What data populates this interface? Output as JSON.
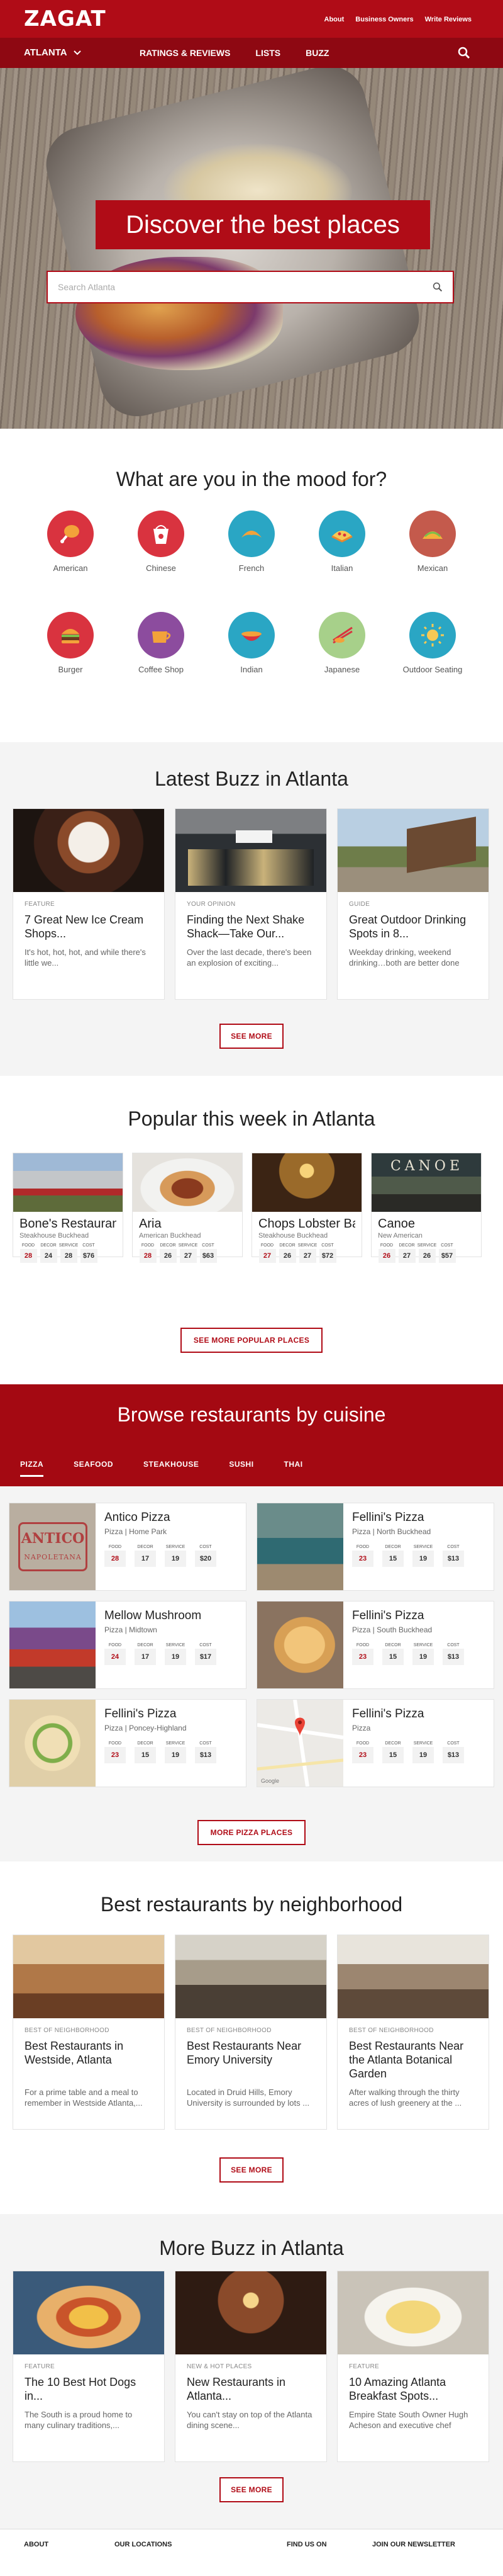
{
  "header": {
    "logo": "ZAGAT",
    "top_links": [
      "About",
      "Business Owners",
      "Write Reviews"
    ],
    "city": "ATLANTA",
    "nav": [
      "RATINGS & REVIEWS",
      "LISTS",
      "BUZZ"
    ]
  },
  "hero": {
    "title": "Discover the best places",
    "search_placeholder": "Search Atlanta"
  },
  "mood": {
    "title": "What are you in the mood for?",
    "items": [
      {
        "label": "American",
        "icon": "chicken-leg-icon",
        "color": "#d9333f"
      },
      {
        "label": "Chinese",
        "icon": "takeout-box-icon",
        "color": "#d9333f"
      },
      {
        "label": "French",
        "icon": "croissant-icon",
        "color": "#2aa6c4"
      },
      {
        "label": "Italian",
        "icon": "pizza-slice-icon",
        "color": "#2aa6c4"
      },
      {
        "label": "Mexican",
        "icon": "taco-icon",
        "color": "#c45a4c"
      },
      {
        "label": "Burger",
        "icon": "burger-icon",
        "color": "#d9333f"
      },
      {
        "label": "Coffee Shop",
        "icon": "coffee-cup-icon",
        "color": "#8c4c9e"
      },
      {
        "label": "Indian",
        "icon": "curry-bowl-icon",
        "color": "#2aa6c4"
      },
      {
        "label": "Japanese",
        "icon": "chopsticks-icon",
        "color": "#a7d08a"
      },
      {
        "label": "Outdoor Seating",
        "icon": "sun-icon",
        "color": "#2aa6c4"
      }
    ]
  },
  "latest_buzz": {
    "title": "Latest Buzz in Atlanta",
    "button": "SEE MORE",
    "cards": [
      {
        "kicker": "FEATURE",
        "title": "7 Great New Ice Cream Shops...",
        "desc": "It's hot, hot, hot, and while there's little we..."
      },
      {
        "kicker": "YOUR OPINION",
        "title": "Finding the Next Shake Shack—Take Our...",
        "desc": "Over the last decade, there's been an explosion of exciting..."
      },
      {
        "kicker": "GUIDE",
        "title": "Great Outdoor Drinking Spots in 8...",
        "desc": "Weekday drinking, weekend drinking…both are better done outdoors. And while..."
      }
    ]
  },
  "popular": {
    "title": "Popular this week in Atlanta",
    "button": "SEE MORE POPULAR PLACES",
    "score_labels": [
      "FOOD",
      "DECOR",
      "SERVICE",
      "COST"
    ],
    "cards": [
      {
        "name": "Bone's Restaurant",
        "cat": "Steakhouse Buckhead",
        "scores": [
          "28",
          "24",
          "28",
          "$76"
        ]
      },
      {
        "name": "Aria",
        "cat": "American Buckhead",
        "scores": [
          "28",
          "26",
          "27",
          "$63"
        ]
      },
      {
        "name": "Chops Lobster Bar",
        "cat": "Steakhouse Buckhead",
        "scores": [
          "27",
          "26",
          "27",
          "$72"
        ]
      },
      {
        "name": "Canoe",
        "cat": "New American",
        "scores": [
          "26",
          "27",
          "26",
          "$57"
        ]
      }
    ]
  },
  "cuisine": {
    "title": "Browse restaurants by cuisine",
    "tabs": [
      "PIZZA",
      "SEAFOOD",
      "STEAKHOUSE",
      "SUSHI",
      "THAI"
    ],
    "button": "MORE PIZZA PLACES",
    "restaurants": [
      {
        "name": "Antico Pizza",
        "sub": "Pizza | Home Park",
        "scores": [
          "28",
          "17",
          "19",
          "$20"
        ]
      },
      {
        "name": "Fellini's Pizza",
        "sub": "Pizza | North Buckhead",
        "scores": [
          "23",
          "15",
          "19",
          "$13"
        ]
      },
      {
        "name": "Mellow Mushroom",
        "sub": "Pizza | Midtown",
        "scores": [
          "24",
          "17",
          "19",
          "$17"
        ]
      },
      {
        "name": "Fellini's Pizza",
        "sub": "Pizza | South Buckhead",
        "scores": [
          "23",
          "15",
          "19",
          "$13"
        ]
      },
      {
        "name": "Fellini's Pizza",
        "sub": "Pizza | Poncey-Highland",
        "scores": [
          "23",
          "15",
          "19",
          "$13"
        ]
      },
      {
        "name": "Fellini's Pizza",
        "sub": "Pizza",
        "scores": [
          "23",
          "15",
          "19",
          "$13"
        ]
      }
    ],
    "antico_sign": "ANTICO",
    "antico_sign2": "NAPOLETANA",
    "map_credit": "Google"
  },
  "neighborhood": {
    "title": "Best restaurants by neighborhood",
    "button": "SEE MORE",
    "cards": [
      {
        "kicker": "BEST OF NEIGHBORHOOD",
        "title": "Best Restaurants in Westside, Atlanta",
        "desc": "For a prime table and a meal to remember in Westside Atlanta,..."
      },
      {
        "kicker": "BEST OF NEIGHBORHOOD",
        "title": "Best Restaurants Near Emory University",
        "desc": "Located in Druid Hills, Emory University is surrounded by lots ..."
      },
      {
        "kicker": "BEST OF NEIGHBORHOOD",
        "title": "Best Restaurants Near the Atlanta Botanical Garden",
        "desc": "After walking through the thirty acres of lush greenery at the ..."
      }
    ]
  },
  "more_buzz": {
    "title": "More Buzz in Atlanta",
    "button": "SEE MORE",
    "cards": [
      {
        "kicker": "FEATURE",
        "title": "The 10 Best Hot Dogs in...",
        "desc": "The South is a proud home to many culinary traditions,..."
      },
      {
        "kicker": "NEW & HOT PLACES",
        "title": "New Restaurants in Atlanta...",
        "desc": "You can't stay on top of the Atlanta dining scene..."
      },
      {
        "kicker": "FEATURE",
        "title": "10 Amazing Atlanta Breakfast Spots...",
        "desc": "Empire State South Owner Hugh Acheson and executive chef Josh..."
      }
    ]
  },
  "footer": {
    "links": [
      "ABOUT",
      "OUR LOCATIONS",
      "FIND US ON",
      "JOIN OUR NEWSLETTER"
    ]
  },
  "colors": {
    "brand_red": "#b00c17",
    "nav_red": "#8e0812",
    "score_red": "#b00c17"
  }
}
